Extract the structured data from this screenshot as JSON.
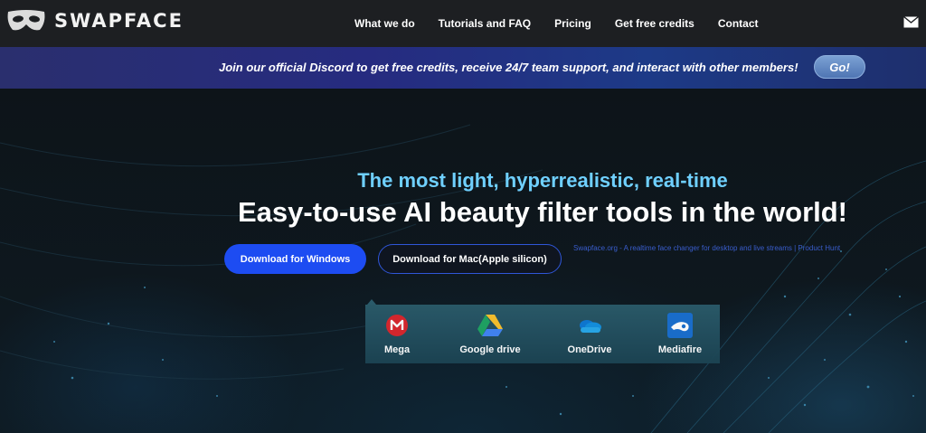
{
  "header": {
    "brand": "SWAPFACE",
    "nav": [
      "What we do",
      "Tutorials and FAQ",
      "Pricing",
      "Get free credits",
      "Contact"
    ]
  },
  "banner": {
    "text": "Join our official Discord to get free credits, receive 24/7 team support, and interact with other members!",
    "go_label": "Go!"
  },
  "hero": {
    "subtitle": "The most light, hyperrealistic, real-time",
    "headline": "Easy-to-use AI beauty filter tools in the world!",
    "download_windows": "Download for Windows",
    "download_mac": "Download for Mac(Apple silicon)",
    "product_hunt_alt": "Swapface.org - A realtime face changer for desktop and live streams | Product Hunt"
  },
  "downloads": [
    {
      "label": "Mega",
      "icon": "mega-icon"
    },
    {
      "label": "Google drive",
      "icon": "google-drive-icon"
    },
    {
      "label": "OneDrive",
      "icon": "onedrive-icon"
    },
    {
      "label": "Mediafire",
      "icon": "mediafire-icon"
    }
  ],
  "colors": {
    "accent_cyan": "#6fd0ff",
    "button_blue": "#1d4cf2",
    "header_bg": "#1d1f22"
  }
}
